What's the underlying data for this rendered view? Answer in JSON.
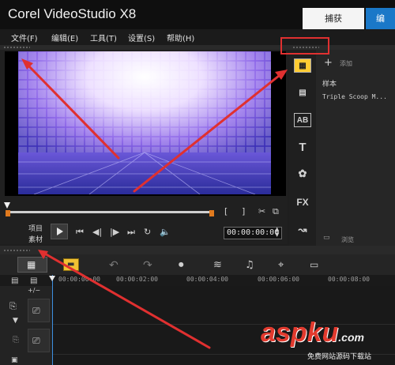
{
  "app": {
    "title": "Corel VideoStudio X8"
  },
  "top_tabs": {
    "capture": "捕获",
    "edit": "编"
  },
  "menu": [
    "文件(F)",
    "编辑(E)",
    "工具(T)",
    "设置(S)",
    "帮助(H)"
  ],
  "player": {
    "mode_project": "项目",
    "mode_clip": "素材",
    "timecode": "00:00:00:00"
  },
  "library": {
    "add_label": "添加",
    "section_title": "样本",
    "item": "Triple Scoop M...",
    "browse_label": "浏览"
  },
  "timeline": {
    "ruler": [
      "00:00:00:00",
      "00:00:02:00",
      "00:00:04:00",
      "00:00:06:00",
      "00:00:08:00"
    ]
  },
  "watermark": {
    "text": "aspku",
    "suffix": ".com",
    "sub": "免费网站源码下载站"
  },
  "colors": {
    "accent_blue": "#1a78c8",
    "annotation_red": "#e03030",
    "trim_orange": "#e07a1e"
  }
}
